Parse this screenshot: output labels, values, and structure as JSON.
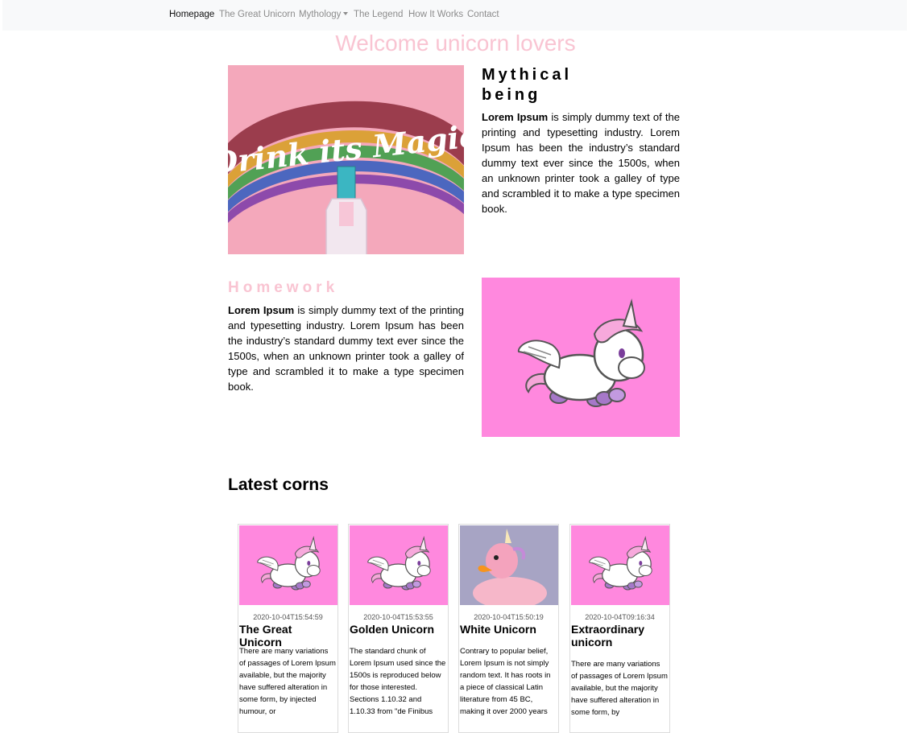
{
  "nav": {
    "items": [
      {
        "label": "Homepage",
        "active": true
      },
      {
        "label": "The Great Unicorn"
      },
      {
        "label": "Mythology",
        "dropdown": true
      },
      {
        "label": "The Legend"
      },
      {
        "label": "How It Works"
      },
      {
        "label": "Contact"
      }
    ]
  },
  "hero": {
    "title": "Welcome unicorn lovers"
  },
  "section1": {
    "image_text": "Drink its Magic",
    "heading_line1": "Mythical",
    "heading_line2": "being",
    "bold": "Lorem Ipsum",
    "text": " is simply dummy text of the printing and typesetting industry. Lorem Ipsum has been the industry’s standard dummy text ever since the 1500s, when an unknown printer took a galley of type and scrambled it to make a type specimen book."
  },
  "section2": {
    "heading": "Homework",
    "bold": "Lorem Ipsum",
    "text": " is simply dummy text of the printing and typesetting industry. Lorem Ipsum has been the industry’s standard dummy text ever since the 1500s, when an unknown printer took a galley of type and scrambled it to make a type specimen book."
  },
  "latest": {
    "heading": "Latest corns",
    "cards": [
      {
        "date": "2020-10-04T15:54:59",
        "title": "The Great Unicorn",
        "text": "There are many variations of passages of Lorem Ipsum available, but the majority have suffered alteration in some form, by injected humour, or"
      },
      {
        "date": "2020-10-04T15:53:55",
        "title": "Golden Unicorn",
        "text": "The standard chunk of Lorem Ipsum used since the 1500s is reproduced below for those interested. Sections 1.10.32 and 1.10.33 from \"de Finibus"
      },
      {
        "date": "2020-10-04T15:50:19",
        "title": "White Unicorn",
        "text": "Contrary to popular belief, Lorem Ipsum is not simply random text. It has roots in a piece of classical Latin literature from 45 BC, making it over 2000 years"
      },
      {
        "date": "2020-10-04T09:16:34",
        "title": "Extraordinary unicorn",
        "text": "There are many variations of passages of Lorem Ipsum available, but the majority have suffered alteration in some form, by"
      }
    ]
  },
  "colors": {
    "accent_pink": "#f9c4d2",
    "unicorn_bg": "#ff88de",
    "drink_bg": "#f4a8bb",
    "navbar_bg": "#f8f9fa"
  }
}
